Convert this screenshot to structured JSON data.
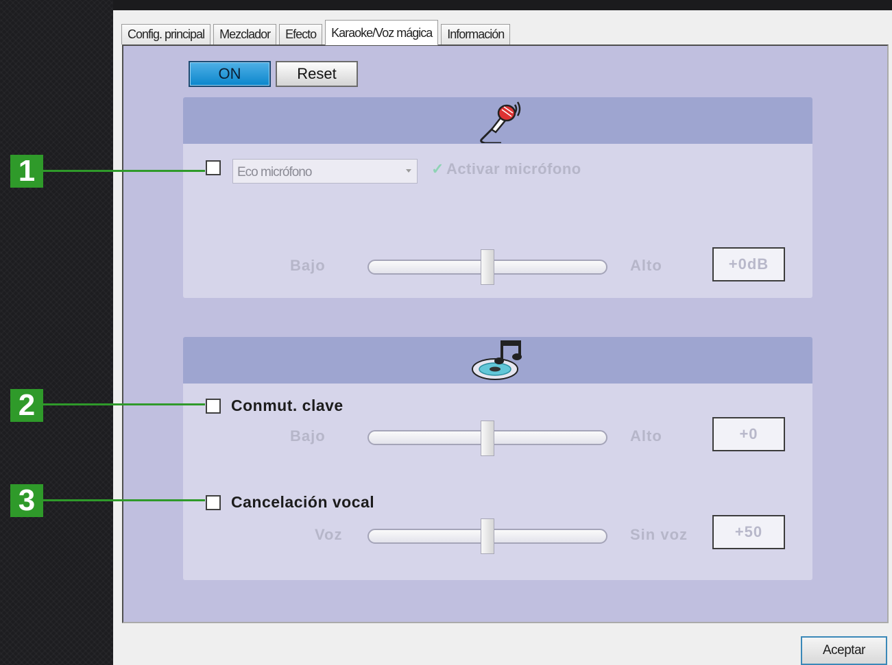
{
  "tabs": [
    {
      "label": "Config. principal"
    },
    {
      "label": "Mezclador"
    },
    {
      "label": "Efecto"
    },
    {
      "label": "Karaoke/Voz mágica"
    },
    {
      "label": "Información"
    }
  ],
  "active_tab": "Karaoke/Voz mágica",
  "buttons": {
    "on": "ON",
    "reset": "Reset",
    "accept": "Aceptar"
  },
  "mic_section": {
    "header_icon": "microphone-icon",
    "checked": false,
    "dropdown_value": "Eco micrófono",
    "activate_label": "Activar micrófono",
    "activate_check": "✓",
    "slider_low": "Bajo",
    "slider_high": "Alto",
    "slider_level": 0.5,
    "value": "+0dB"
  },
  "music_section": {
    "header_icon": "music-cd-icon",
    "key_change": {
      "label": "Conmut. clave",
      "checked": false,
      "slider_low": "Bajo",
      "slider_high": "Alto",
      "slider_level": 0.5,
      "value": "+0"
    },
    "vocal_cancel": {
      "label": "Cancelación vocal",
      "checked": false,
      "slider_low": "Voz",
      "slider_high": "Sin voz",
      "slider_level": 0.5,
      "value": "+50"
    }
  },
  "callouts": [
    "1",
    "2",
    "3"
  ],
  "colors": {
    "panel": "#c0bfdf",
    "section_header": "#9ea5d0",
    "on_button": "#0b86cc",
    "callout": "#2f9a2a"
  }
}
